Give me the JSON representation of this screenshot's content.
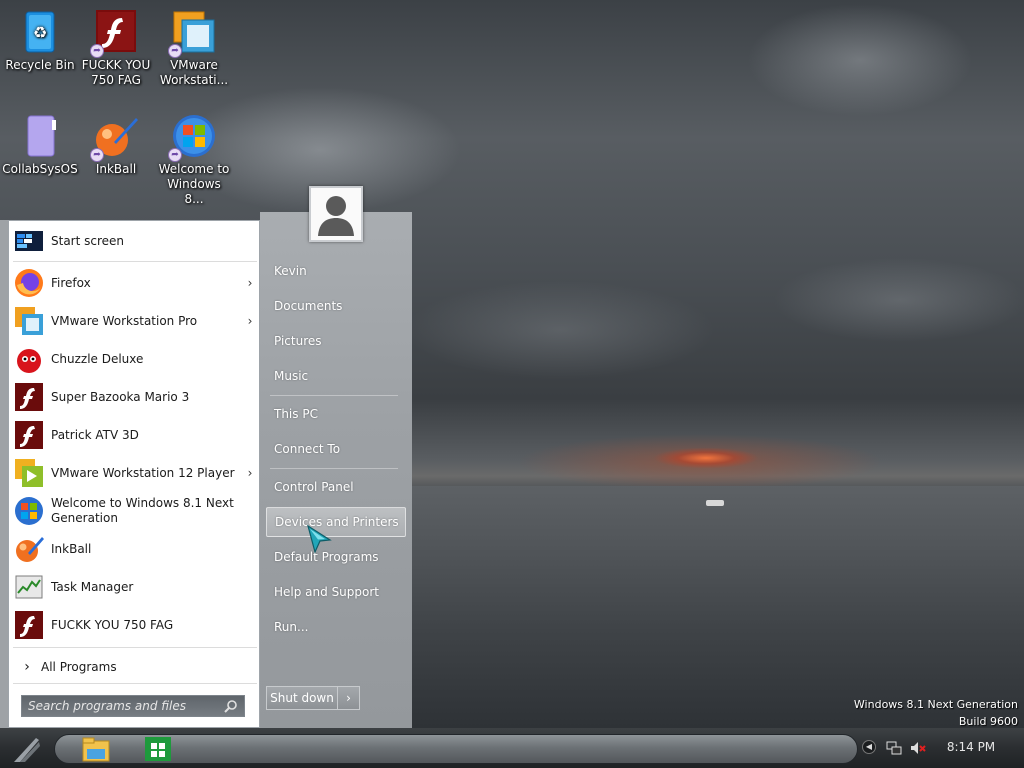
{
  "desktop": {
    "icons": [
      {
        "label": "Recycle Bin"
      },
      {
        "label": "FUCKK YOU 750 FAG"
      },
      {
        "label": "VMware Workstati..."
      },
      {
        "label": "CollabSysOS"
      },
      {
        "label": "InkBall"
      },
      {
        "label": "Welcome to Windows 8..."
      }
    ],
    "watermark": {
      "line1": "Windows 8.1 Next Generation",
      "line2": "Build 9600"
    }
  },
  "start_menu": {
    "programs": [
      {
        "label": "Start screen",
        "icon": "start-screen-icon",
        "submenu": false
      },
      {
        "label": "Firefox",
        "icon": "firefox-icon",
        "submenu": true
      },
      {
        "label": "VMware Workstation Pro",
        "icon": "vmware-icon",
        "submenu": true
      },
      {
        "label": "Chuzzle Deluxe",
        "icon": "chuzzle-icon",
        "submenu": false
      },
      {
        "label": "Super Bazooka Mario 3",
        "icon": "flash-icon",
        "submenu": false
      },
      {
        "label": "Patrick ATV 3D",
        "icon": "flash-icon",
        "submenu": false
      },
      {
        "label": "VMware Workstation 12 Player",
        "icon": "vmware-player-icon",
        "submenu": true
      },
      {
        "label": "Welcome to Windows 8.1 Next Generation",
        "icon": "windows-logo-icon",
        "submenu": false
      },
      {
        "label": "InkBall",
        "icon": "inkball-icon",
        "submenu": false
      },
      {
        "label": "Task Manager",
        "icon": "task-manager-icon",
        "submenu": false
      },
      {
        "label": "FUCKK YOU 750 FAG",
        "icon": "flash-icon",
        "submenu": false
      }
    ],
    "all_programs": "All Programs",
    "search_placeholder": "Search programs and files",
    "right_pane": [
      {
        "label": "Kevin"
      },
      {
        "label": "Documents"
      },
      {
        "label": "Pictures"
      },
      {
        "label": "Music"
      },
      {
        "label": "This PC"
      },
      {
        "label": "Connect To"
      },
      {
        "label": "Control Panel"
      },
      {
        "label": "Devices and Printers"
      },
      {
        "label": "Default Programs"
      },
      {
        "label": "Help and Support"
      },
      {
        "label": "Run..."
      }
    ],
    "hovered_item": "Devices and Printers",
    "shutdown_label": "Shut down"
  },
  "taskbar": {
    "clock": "8:14 PM",
    "pinned": [
      "file-explorer-icon",
      "store-icon"
    ]
  },
  "colors": {
    "start_menu_left": "#ffffff",
    "start_menu_right": "#9da1a5",
    "taskbar": "#2b2e31",
    "flash_red": "#8b1010"
  }
}
